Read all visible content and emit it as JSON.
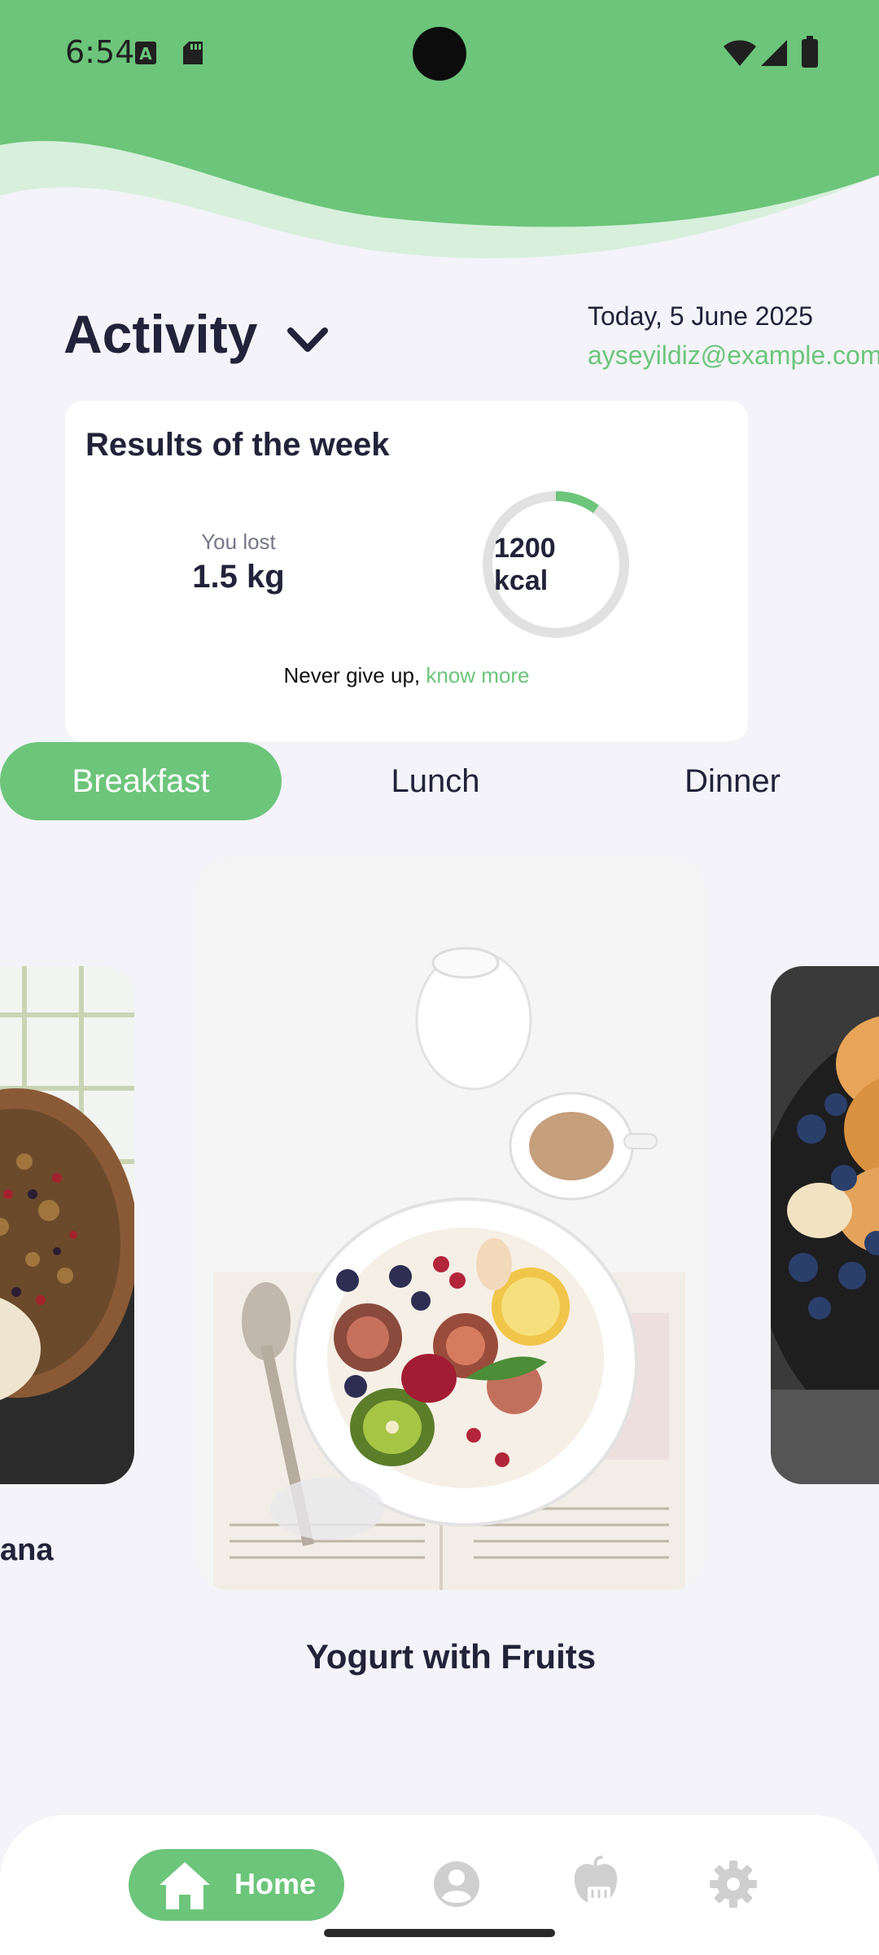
{
  "status_bar": {
    "time": "6:54",
    "icons": [
      "a-notification-icon",
      "sd-card-icon",
      "wifi-icon",
      "signal-icon",
      "battery-icon"
    ]
  },
  "activity": {
    "title": "Activity",
    "date": "Today, 5 June 2025",
    "email": "ayseyildiz@example.com"
  },
  "results": {
    "title": "Results of the week",
    "lost_label": "You lost",
    "lost_value": "1.5 kg",
    "kcal_value": "1200",
    "kcal_unit": "kcal",
    "kcal_progress": 0.1,
    "motivation_prefix": "Never give up, ",
    "know_more": "know more"
  },
  "meal_tabs": {
    "active": "Breakfast",
    "items": [
      "Breakfast",
      "Lunch",
      "Dinner"
    ]
  },
  "carousel": {
    "left_caption": "ana",
    "center_caption": "Yogurt with Fruits"
  },
  "bottom_nav": {
    "home_label": "Home",
    "items": [
      "home-icon",
      "profile-icon",
      "apple-scale-icon",
      "settings-icon"
    ]
  },
  "colors": {
    "accent": "#6cc57a",
    "background": "#f3f3f9",
    "text": "#22223a"
  }
}
